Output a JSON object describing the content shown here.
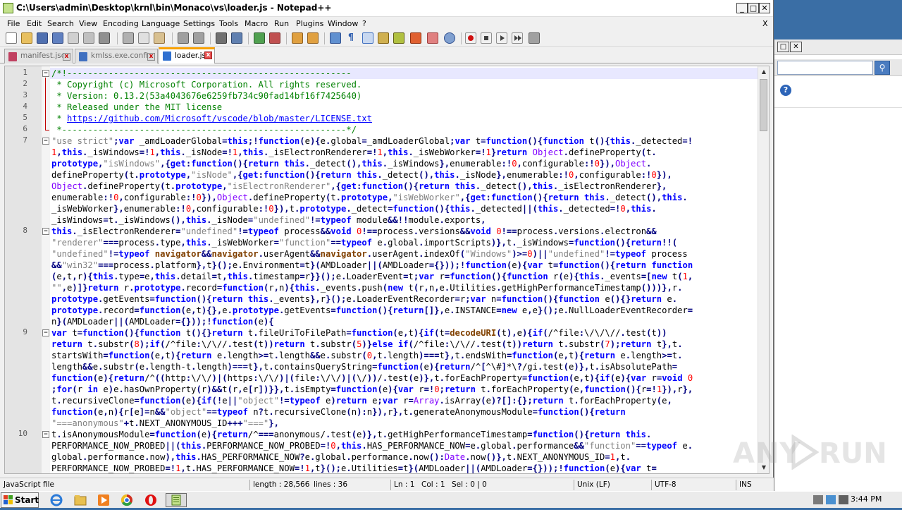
{
  "window": {
    "title": "C:\\Users\\admin\\Desktop\\krnl\\bin\\Monaco\\vs\\loader.js - Notepad++",
    "min_label": "_",
    "max_label": "□",
    "close_label": "✕"
  },
  "menu": {
    "items": [
      "File",
      "Edit",
      "Search",
      "View",
      "Encoding",
      "Language",
      "Settings",
      "Tools",
      "Macro",
      "Run",
      "Plugins",
      "Window",
      "?"
    ],
    "close_label": "X"
  },
  "tabs": [
    {
      "label": "manifest.json",
      "active": false,
      "icon_color": "#c04060"
    },
    {
      "label": "kmlss.exe.config",
      "active": false,
      "icon_color": "#4070c0"
    },
    {
      "label": "loader.js",
      "active": true,
      "icon_color": "#3070d0"
    }
  ],
  "editor": {
    "line_numbers": [
      {
        "n": "1",
        "row": 0
      },
      {
        "n": "2",
        "row": 1
      },
      {
        "n": "3",
        "row": 2
      },
      {
        "n": "4",
        "row": 3
      },
      {
        "n": "5",
        "row": 4
      },
      {
        "n": "6",
        "row": 5
      },
      {
        "n": "7",
        "row": 6
      },
      {
        "n": "8",
        "row": 14
      },
      {
        "n": "9",
        "row": 23
      },
      {
        "n": "10",
        "row": 32
      }
    ],
    "lines": [
      "/*!-------------------------------------------------------",
      " * Copyright (c) Microsoft Corporation. All rights reserved.",
      " * Version: 0.13.2(53a4043676e6259fb734c90fad14bf16f7425640)",
      " * Released under the MIT license",
      " * https://github.com/Microsoft/vscode/blob/master/LICENSE.txt",
      " *-------------------------------------------------------*/",
      "\"use strict\";var _amdLoaderGlobal=this;!function(e){e.global=_amdLoaderGlobal;var t=function(){function t(){this._detected=!",
      "1,this._isWindows=!1,this._isNode=!1,this._isElectronRenderer=!1,this._isWebWorker=!1}return Object.defineProperty(t.",
      "prototype,\"isWindows\",{get:function(){return this._detect(),this._isWindows},enumerable:!0,configurable:!0}),Object.",
      "defineProperty(t.prototype,\"isNode\",{get:function(){return this._detect(),this._isNode},enumerable:!0,configurable:!0}),",
      "Object.defineProperty(t.prototype,\"isElectronRenderer\",{get:function(){return this._detect(),this._isElectronRenderer},",
      "enumerable:!0,configurable:!0}),Object.defineProperty(t.prototype,\"isWebWorker\",{get:function(){return this._detect(),this.",
      "_isWebWorker},enumerable:!0,configurable:!0}),t.prototype._detect=function(){this._detected||(this._detected=!0,this.",
      "_isWindows=t._isWindows(),this._isNode=\"undefined\"!=typeof module&&!!module.exports,",
      "this._isElectronRenderer=\"undefined\"!=typeof process&&void 0!==process.versions&&void 0!==process.versions.electron&&",
      "\"renderer\"===process.type,this._isWebWorker=\"function\"==typeof e.global.importScripts)},t._isWindows=function(){return!!(",
      "\"undefined\"!=typeof navigator&&navigator.userAgent&&navigator.userAgent.indexOf(\"Windows\")>=0)||\"undefined\"!=typeof process",
      "&&\"win32\"===process.platform},t}();e.Environment=t}(AMDLoader||(AMDLoader={}));!function(e){var t=function(){return function",
      "(e,t,r){this.type=e,this.detail=t,this.timestamp=r}}();e.LoaderEvent=t;var r=function(){function r(e){this._events=[new t(1,",
      "\"\",e)]}return r.prototype.record=function(r,n){this._events.push(new t(r,n,e.Utilities.getHighPerformanceTimestamp()))},r.",
      "prototype.getEvents=function(){return this._events},r}();e.LoaderEventRecorder=r;var n=function(){function e(){}return e.",
      "prototype.record=function(e,t){},e.prototype.getEvents=function(){return[]},e.INSTANCE=new e,e}();e.NullLoaderEventRecorder=",
      "n}(AMDLoader||(AMDLoader={}));!function(e){",
      "var t=function(){function t(){}return t.fileUriToFilePath=function(e,t){if(t=decodeURI(t),e){if(/^file:\\/\\/\\//.test(t))",
      "return t.substr(8);if(/^file:\\/\\//.test(t))return t.substr(5)}else if(/^file:\\/\\//.test(t))return t.substr(7);return t},t.",
      "startsWith=function(e,t){return e.length>=t.length&&e.substr(0,t.length)===t},t.endsWith=function(e,t){return e.length>=t.",
      "length&&e.substr(e.length-t.length)===t},t.containsQueryString=function(e){return/^[^\\#]*\\?/gi.test(e)},t.isAbsolutePath=",
      "function(e){return/^((http:\\/\\/)|(https:\\/\\/)|(file:\\/\\/)|(\\/))/.test(e)},t.forEachProperty=function(e,t){if(e){var r=void 0",
      ";for(r in e)e.hasOwnProperty(r)&&t(r,e[r])}},t.isEmpty=function(e){var r=!0;return t.forEachProperty(e,function(){r=!1}),r},",
      "t.recursiveClone=function(e){if(!e||\"object\"!=typeof e)return e;var r=Array.isArray(e)?[]:{};return t.forEachProperty(e,",
      "function(e,n){r[e]=n&&\"object\"==typeof n?t.recursiveClone(n):n}),r},t.generateAnonymousModule=function(){return",
      "\"===anonymous\"+t.NEXT_ANONYMOUS_ID+++\"===\"},",
      "t.isAnonymousModule=function(e){return/^===anonymous/.test(e)},t.getHighPerformanceTimestamp=function(){return this.",
      "PERFORMANCE_NOW_PROBED||(this.PERFORMANCE_NOW_PROBED=!0,this.HAS_PERFORMANCE_NOW=e.global.performance&&\"function\"==typeof e.",
      "global.performance.now),this.HAS_PERFORMANCE_NOW?e.global.performance.now():Date.now()},t.NEXT_ANONYMOUS_ID=1,t.",
      "PERFORMANCE_NOW_PROBED=!1,t.HAS_PERFORMANCE_NOW=!1,t}();e.Utilities=t}(AMDLoader||(AMDLoader={}));!function(e){var t="
    ]
  },
  "status": {
    "file_type": "JavaScript file",
    "length": "length : 28,566",
    "lines": "lines : 36",
    "ln": "Ln : 1",
    "col": "Col : 1",
    "sel": "Sel : 0 | 0",
    "eol": "Unix (LF)",
    "encoding": "UTF-8",
    "mode": "INS"
  },
  "watermark": {
    "left": "ANY",
    "right": "RUN"
  },
  "taskbar": {
    "start_label": "Start",
    "clock": "3:44 PM"
  },
  "colors": {
    "keyword": "#0000ff",
    "string": "#808080",
    "comment": "#008000",
    "number": "#ff0000",
    "regex": "#8000ff"
  }
}
